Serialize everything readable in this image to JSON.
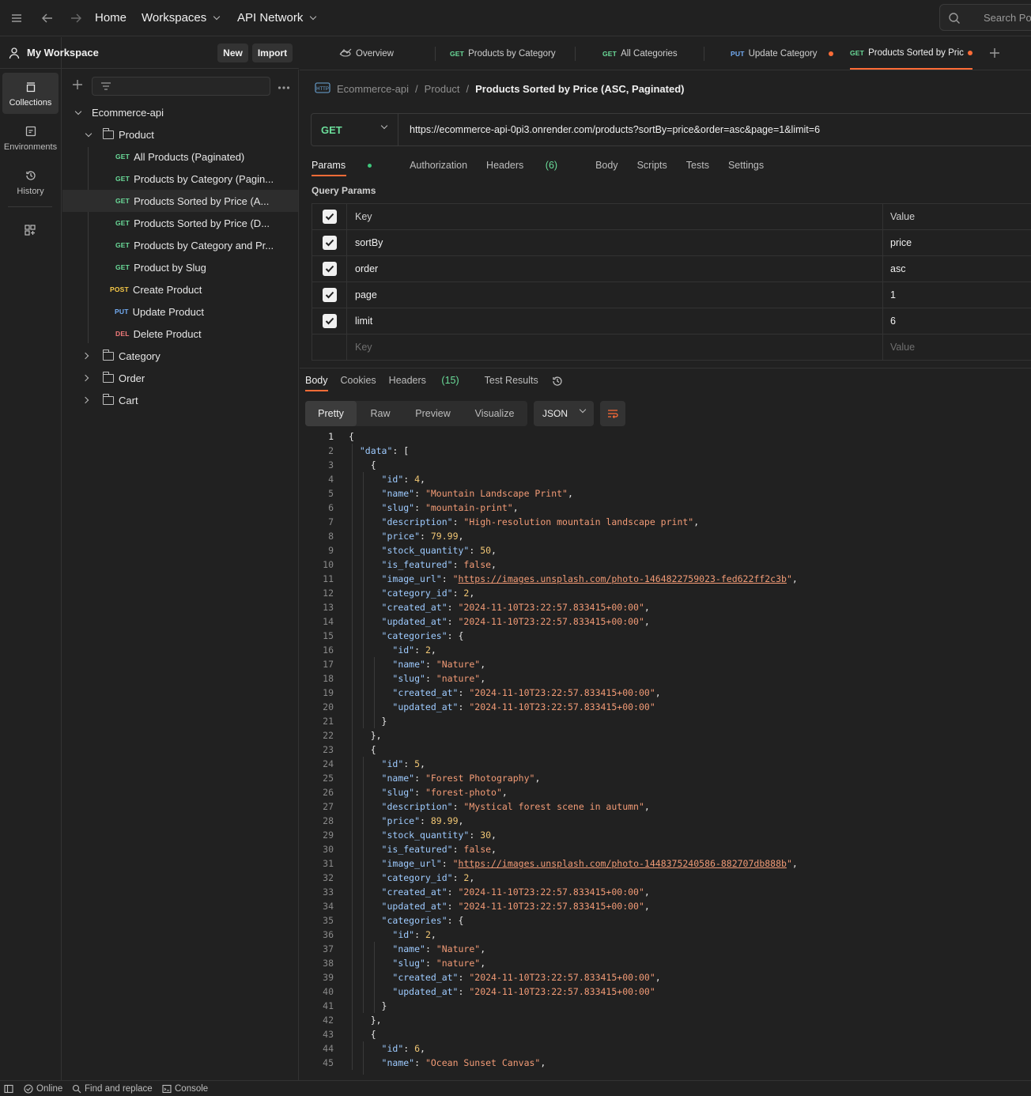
{
  "topbar": {
    "home": "Home",
    "workspaces": "Workspaces",
    "api_network": "API Network",
    "search_placeholder": "Search Pos"
  },
  "rail": {
    "collections": "Collections",
    "environments": "Environments",
    "history": "History"
  },
  "workspace": {
    "name": "My Workspace",
    "new_label": "New",
    "import_label": "Import"
  },
  "tree": {
    "collection": "Ecommerce-api",
    "folder_product": "Product",
    "requests": [
      {
        "method": "GET",
        "label": "All Products (Paginated)"
      },
      {
        "method": "GET",
        "label": "Products by Category (Pagin..."
      },
      {
        "method": "GET",
        "label": "Products Sorted by Price (A..."
      },
      {
        "method": "GET",
        "label": "Products Sorted by Price (D..."
      },
      {
        "method": "GET",
        "label": "Products by Category and Pr..."
      },
      {
        "method": "GET",
        "label": "Product by Slug"
      },
      {
        "method": "POST",
        "label": "Create Product"
      },
      {
        "method": "PUT",
        "label": "Update Product"
      },
      {
        "method": "DEL",
        "label": "Delete Product"
      }
    ],
    "folders": [
      "Category",
      "Order",
      "Cart"
    ]
  },
  "tabs": [
    {
      "method": "",
      "label": "Overview"
    },
    {
      "method": "GET",
      "label": "Products by Category"
    },
    {
      "method": "GET",
      "label": "All Categories"
    },
    {
      "method": "PUT",
      "label": "Update Category"
    },
    {
      "method": "GET",
      "label": "Products Sorted by Pric"
    }
  ],
  "breadcrumb": {
    "collection": "Ecommerce-api",
    "folder": "Product",
    "current": "Products Sorted by Price (ASC, Paginated)",
    "sep": "/"
  },
  "request": {
    "method": "GET",
    "url": "https://ecommerce-api-0pi3.onrender.com/products?sortBy=price&order=asc&page=1&limit=6"
  },
  "req_tabs": {
    "params": "Params",
    "authorization": "Authorization",
    "headers": "Headers",
    "headers_count": "(6)",
    "body": "Body",
    "scripts": "Scripts",
    "tests": "Tests",
    "settings": "Settings"
  },
  "query_params": {
    "title": "Query Params",
    "key_header": "Key",
    "value_header": "Value",
    "rows": [
      {
        "key": "sortBy",
        "value": "price"
      },
      {
        "key": "order",
        "value": "asc"
      },
      {
        "key": "page",
        "value": "1"
      },
      {
        "key": "limit",
        "value": "6"
      }
    ],
    "key_placeholder": "Key",
    "value_placeholder": "Value"
  },
  "response": {
    "tabs": {
      "body": "Body",
      "cookies": "Cookies",
      "headers": "Headers",
      "headers_count": "(15)",
      "test_results": "Test Results"
    },
    "views": [
      "Pretty",
      "Raw",
      "Preview",
      "Visualize"
    ],
    "format": "JSON"
  },
  "code_lines": [
    [
      [
        "p",
        "{"
      ]
    ],
    [
      [
        "p",
        "  "
      ],
      [
        "k",
        "\"data\""
      ],
      [
        "p",
        ": ["
      ]
    ],
    [
      [
        "p",
        "    {"
      ]
    ],
    [
      [
        "p",
        "      "
      ],
      [
        "k",
        "\"id\""
      ],
      [
        "p",
        ": "
      ],
      [
        "n",
        "4"
      ],
      [
        "p",
        ","
      ]
    ],
    [
      [
        "p",
        "      "
      ],
      [
        "k",
        "\"name\""
      ],
      [
        "p",
        ": "
      ],
      [
        "s",
        "\"Mountain Landscape Print\""
      ],
      [
        "p",
        ","
      ]
    ],
    [
      [
        "p",
        "      "
      ],
      [
        "k",
        "\"slug\""
      ],
      [
        "p",
        ": "
      ],
      [
        "s",
        "\"mountain-print\""
      ],
      [
        "p",
        ","
      ]
    ],
    [
      [
        "p",
        "      "
      ],
      [
        "k",
        "\"description\""
      ],
      [
        "p",
        ": "
      ],
      [
        "s",
        "\"High-resolution mountain landscape print\""
      ],
      [
        "p",
        ","
      ]
    ],
    [
      [
        "p",
        "      "
      ],
      [
        "k",
        "\"price\""
      ],
      [
        "p",
        ": "
      ],
      [
        "n",
        "79.99"
      ],
      [
        "p",
        ","
      ]
    ],
    [
      [
        "p",
        "      "
      ],
      [
        "k",
        "\"stock_quantity\""
      ],
      [
        "p",
        ": "
      ],
      [
        "n",
        "50"
      ],
      [
        "p",
        ","
      ]
    ],
    [
      [
        "p",
        "      "
      ],
      [
        "k",
        "\"is_featured\""
      ],
      [
        "p",
        ": "
      ],
      [
        "b",
        "false"
      ],
      [
        "p",
        ","
      ]
    ],
    [
      [
        "p",
        "      "
      ],
      [
        "k",
        "\"image_url\""
      ],
      [
        "p",
        ": "
      ],
      [
        "s",
        "\""
      ],
      [
        "u",
        "https://images.unsplash.com/photo-1464822759023-fed622ff2c3b"
      ],
      [
        "s",
        "\""
      ],
      [
        "p",
        ","
      ]
    ],
    [
      [
        "p",
        "      "
      ],
      [
        "k",
        "\"category_id\""
      ],
      [
        "p",
        ": "
      ],
      [
        "n",
        "2"
      ],
      [
        "p",
        ","
      ]
    ],
    [
      [
        "p",
        "      "
      ],
      [
        "k",
        "\"created_at\""
      ],
      [
        "p",
        ": "
      ],
      [
        "s",
        "\"2024-11-10T23:22:57.833415+00:00\""
      ],
      [
        "p",
        ","
      ]
    ],
    [
      [
        "p",
        "      "
      ],
      [
        "k",
        "\"updated_at\""
      ],
      [
        "p",
        ": "
      ],
      [
        "s",
        "\"2024-11-10T23:22:57.833415+00:00\""
      ],
      [
        "p",
        ","
      ]
    ],
    [
      [
        "p",
        "      "
      ],
      [
        "k",
        "\"categories\""
      ],
      [
        "p",
        ": {"
      ]
    ],
    [
      [
        "p",
        "        "
      ],
      [
        "k",
        "\"id\""
      ],
      [
        "p",
        ": "
      ],
      [
        "n",
        "2"
      ],
      [
        "p",
        ","
      ]
    ],
    [
      [
        "p",
        "        "
      ],
      [
        "k",
        "\"name\""
      ],
      [
        "p",
        ": "
      ],
      [
        "s",
        "\"Nature\""
      ],
      [
        "p",
        ","
      ]
    ],
    [
      [
        "p",
        "        "
      ],
      [
        "k",
        "\"slug\""
      ],
      [
        "p",
        ": "
      ],
      [
        "s",
        "\"nature\""
      ],
      [
        "p",
        ","
      ]
    ],
    [
      [
        "p",
        "        "
      ],
      [
        "k",
        "\"created_at\""
      ],
      [
        "p",
        ": "
      ],
      [
        "s",
        "\"2024-11-10T23:22:57.833415+00:00\""
      ],
      [
        "p",
        ","
      ]
    ],
    [
      [
        "p",
        "        "
      ],
      [
        "k",
        "\"updated_at\""
      ],
      [
        "p",
        ": "
      ],
      [
        "s",
        "\"2024-11-10T23:22:57.833415+00:00\""
      ]
    ],
    [
      [
        "p",
        "      }"
      ]
    ],
    [
      [
        "p",
        "    },"
      ]
    ],
    [
      [
        "p",
        "    {"
      ]
    ],
    [
      [
        "p",
        "      "
      ],
      [
        "k",
        "\"id\""
      ],
      [
        "p",
        ": "
      ],
      [
        "n",
        "5"
      ],
      [
        "p",
        ","
      ]
    ],
    [
      [
        "p",
        "      "
      ],
      [
        "k",
        "\"name\""
      ],
      [
        "p",
        ": "
      ],
      [
        "s",
        "\"Forest Photography\""
      ],
      [
        "p",
        ","
      ]
    ],
    [
      [
        "p",
        "      "
      ],
      [
        "k",
        "\"slug\""
      ],
      [
        "p",
        ": "
      ],
      [
        "s",
        "\"forest-photo\""
      ],
      [
        "p",
        ","
      ]
    ],
    [
      [
        "p",
        "      "
      ],
      [
        "k",
        "\"description\""
      ],
      [
        "p",
        ": "
      ],
      [
        "s",
        "\"Mystical forest scene in autumn\""
      ],
      [
        "p",
        ","
      ]
    ],
    [
      [
        "p",
        "      "
      ],
      [
        "k",
        "\"price\""
      ],
      [
        "p",
        ": "
      ],
      [
        "n",
        "89.99"
      ],
      [
        "p",
        ","
      ]
    ],
    [
      [
        "p",
        "      "
      ],
      [
        "k",
        "\"stock_quantity\""
      ],
      [
        "p",
        ": "
      ],
      [
        "n",
        "30"
      ],
      [
        "p",
        ","
      ]
    ],
    [
      [
        "p",
        "      "
      ],
      [
        "k",
        "\"is_featured\""
      ],
      [
        "p",
        ": "
      ],
      [
        "b",
        "false"
      ],
      [
        "p",
        ","
      ]
    ],
    [
      [
        "p",
        "      "
      ],
      [
        "k",
        "\"image_url\""
      ],
      [
        "p",
        ": "
      ],
      [
        "s",
        "\""
      ],
      [
        "u",
        "https://images.unsplash.com/photo-1448375240586-882707db888b"
      ],
      [
        "s",
        "\""
      ],
      [
        "p",
        ","
      ]
    ],
    [
      [
        "p",
        "      "
      ],
      [
        "k",
        "\"category_id\""
      ],
      [
        "p",
        ": "
      ],
      [
        "n",
        "2"
      ],
      [
        "p",
        ","
      ]
    ],
    [
      [
        "p",
        "      "
      ],
      [
        "k",
        "\"created_at\""
      ],
      [
        "p",
        ": "
      ],
      [
        "s",
        "\"2024-11-10T23:22:57.833415+00:00\""
      ],
      [
        "p",
        ","
      ]
    ],
    [
      [
        "p",
        "      "
      ],
      [
        "k",
        "\"updated_at\""
      ],
      [
        "p",
        ": "
      ],
      [
        "s",
        "\"2024-11-10T23:22:57.833415+00:00\""
      ],
      [
        "p",
        ","
      ]
    ],
    [
      [
        "p",
        "      "
      ],
      [
        "k",
        "\"categories\""
      ],
      [
        "p",
        ": {"
      ]
    ],
    [
      [
        "p",
        "        "
      ],
      [
        "k",
        "\"id\""
      ],
      [
        "p",
        ": "
      ],
      [
        "n",
        "2"
      ],
      [
        "p",
        ","
      ]
    ],
    [
      [
        "p",
        "        "
      ],
      [
        "k",
        "\"name\""
      ],
      [
        "p",
        ": "
      ],
      [
        "s",
        "\"Nature\""
      ],
      [
        "p",
        ","
      ]
    ],
    [
      [
        "p",
        "        "
      ],
      [
        "k",
        "\"slug\""
      ],
      [
        "p",
        ": "
      ],
      [
        "s",
        "\"nature\""
      ],
      [
        "p",
        ","
      ]
    ],
    [
      [
        "p",
        "        "
      ],
      [
        "k",
        "\"created_at\""
      ],
      [
        "p",
        ": "
      ],
      [
        "s",
        "\"2024-11-10T23:22:57.833415+00:00\""
      ],
      [
        "p",
        ","
      ]
    ],
    [
      [
        "p",
        "        "
      ],
      [
        "k",
        "\"updated_at\""
      ],
      [
        "p",
        ": "
      ],
      [
        "s",
        "\"2024-11-10T23:22:57.833415+00:00\""
      ]
    ],
    [
      [
        "p",
        "      }"
      ]
    ],
    [
      [
        "p",
        "    },"
      ]
    ],
    [
      [
        "p",
        "    {"
      ]
    ],
    [
      [
        "p",
        "      "
      ],
      [
        "k",
        "\"id\""
      ],
      [
        "p",
        ": "
      ],
      [
        "n",
        "6"
      ],
      [
        "p",
        ","
      ]
    ],
    [
      [
        "p",
        "      "
      ],
      [
        "k",
        "\"name\""
      ],
      [
        "p",
        ": "
      ],
      [
        "s",
        "\"Ocean Sunset Canvas\""
      ],
      [
        "p",
        ","
      ]
    ]
  ],
  "statusbar": {
    "online": "Online",
    "find_replace": "Find and replace",
    "console": "Console"
  },
  "colors": {
    "accent": "#ff6c37",
    "get": "#6bdd9a",
    "post": "#f7c948",
    "put": "#74aef6",
    "delete": "#f27a7a"
  }
}
